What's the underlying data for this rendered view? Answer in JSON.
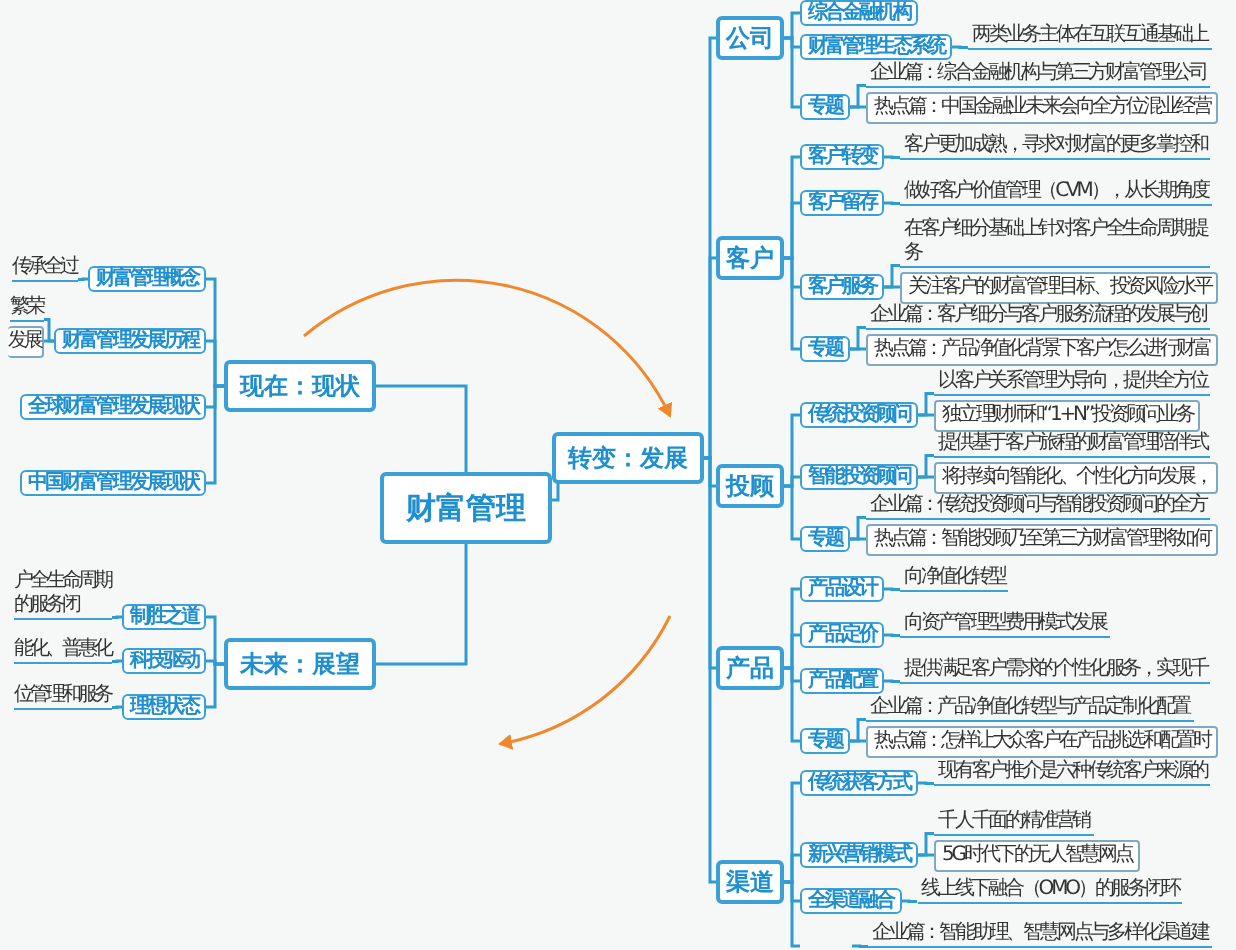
{
  "root": {
    "label": "财富管理"
  },
  "branches": [
    {
      "label": "现在：现状",
      "children": [
        {
          "label": "财富管理概念",
          "notes": [
            {
              "lines": [
                "传承全过"
              ],
              "boxed": false
            }
          ]
        },
        {
          "label": "财富管理发展历程",
          "notes": [
            {
              "lines": [
                "繁荣"
              ],
              "boxed": false
            },
            {
              "lines": [
                "发展"
              ],
              "boxed": true
            }
          ]
        },
        {
          "label": "全球财富管理发展现状"
        },
        {
          "label": "中国财富管理发展现状"
        }
      ]
    },
    {
      "label": "转变：发展",
      "children": [
        {
          "label": "公司",
          "children": [
            {
              "label": "综合金融机构"
            },
            {
              "label": "财富管理生态系统",
              "notes": [
                {
                  "lines": [
                    "两类业务主体在互联互通基础上"
                  ],
                  "boxed": false
                }
              ]
            },
            {
              "label": "专题",
              "notes": [
                {
                  "lines": [
                    "企业篇：综合金融机构与第三方财富管理公司"
                  ],
                  "boxed": false
                },
                {
                  "lines": [
                    "热点篇：中国金融业未来会向全方位混业经营"
                  ],
                  "boxed": true
                }
              ]
            }
          ]
        },
        {
          "label": "客户",
          "children": [
            {
              "label": "客户转变",
              "notes": [
                {
                  "lines": [
                    "客户更加成熟，寻求对财富的更多掌控和"
                  ],
                  "boxed": false
                }
              ]
            },
            {
              "label": "客户留存",
              "notes": [
                {
                  "lines": [
                    "做好客户价值管理（CVM），从长期角度"
                  ],
                  "boxed": false
                }
              ]
            },
            {
              "label": "客户服务",
              "notes": [
                {
                  "lines": [
                    "在客户细分基础上针对客户全生命周期提",
                    "务"
                  ],
                  "boxed": false
                },
                {
                  "lines": [
                    "关注客户的财富管理目标、投资风险水平"
                  ],
                  "boxed": true
                }
              ]
            },
            {
              "label": "专题",
              "notes": [
                {
                  "lines": [
                    "企业篇：客户细分与客户服务流程的发展与创"
                  ],
                  "boxed": false
                },
                {
                  "lines": [
                    "热点篇：产品净值化背景下客户怎么进行财富"
                  ],
                  "boxed": true
                }
              ]
            }
          ]
        },
        {
          "label": "投顾",
          "children": [
            {
              "label": "传统投资顾问",
              "notes": [
                {
                  "lines": [
                    "以客户关系管理为导向，提供全方位"
                  ],
                  "boxed": false
                },
                {
                  "lines": [
                    "独立理财师和“1+N”投资顾问业务"
                  ],
                  "boxed": true
                }
              ]
            },
            {
              "label": "智能投资顾问",
              "notes": [
                {
                  "lines": [
                    "提供基于客户旅程的财富管理陪伴式"
                  ],
                  "boxed": false
                },
                {
                  "lines": [
                    "将持续向智能化、个性化方向发展，"
                  ],
                  "boxed": true
                }
              ]
            },
            {
              "label": "专题",
              "notes": [
                {
                  "lines": [
                    "企业篇：传统投资顾问与智能投资顾问的全方"
                  ],
                  "boxed": false
                },
                {
                  "lines": [
                    "热点篇：智能投顾乃至第三方财富管理将如何"
                  ],
                  "boxed": true
                }
              ]
            }
          ]
        },
        {
          "label": "产品",
          "children": [
            {
              "label": "产品设计",
              "notes": [
                {
                  "lines": [
                    "向净值化转型"
                  ],
                  "boxed": false
                }
              ]
            },
            {
              "label": "产品定价",
              "notes": [
                {
                  "lines": [
                    "向资产管理型费用模式发展"
                  ],
                  "boxed": false
                }
              ]
            },
            {
              "label": "产品配置",
              "notes": [
                {
                  "lines": [
                    "提供满足客户需求的个性化服务，实现千"
                  ],
                  "boxed": false
                }
              ]
            },
            {
              "label": "专题",
              "notes": [
                {
                  "lines": [
                    "企业篇：产品净值化转型与产品定制化配置"
                  ],
                  "boxed": false
                },
                {
                  "lines": [
                    "热点篇：怎样让大众客户在产品挑选和配置时"
                  ],
                  "boxed": true
                }
              ]
            }
          ]
        },
        {
          "label": "渠道",
          "children": [
            {
              "label": "传统获客方式",
              "notes": [
                {
                  "lines": [
                    "现有客户推介是六种传统客户来源的"
                  ],
                  "boxed": false
                }
              ]
            },
            {
              "label": "新兴营销模式",
              "notes": [
                {
                  "lines": [
                    "千人千面的精准营销"
                  ],
                  "boxed": false
                },
                {
                  "lines": [
                    "5G时代下的无人智慧网点"
                  ],
                  "boxed": true
                }
              ]
            },
            {
              "label": "全渠道融合",
              "notes": [
                {
                  "lines": [
                    "线上线下融合（OMO）的服务闭环"
                  ],
                  "boxed": false
                }
              ]
            },
            {
              "notes": [
                {
                  "lines": [
                    "企业篇：智能助理、智慧网点与多样化渠道建"
                  ],
                  "boxed": false
                }
              ]
            }
          ]
        }
      ]
    },
    {
      "label": "未来：展望",
      "children": [
        {
          "label": "制胜之道",
          "notes": [
            {
              "lines": [
                "户全生命周期",
                "的服务闭"
              ],
              "boxed": false
            }
          ]
        },
        {
          "label": "科技驱动",
          "notes": [
            {
              "lines": [
                "能化、普惠化"
              ],
              "boxed": false
            }
          ]
        },
        {
          "label": "理想状态",
          "notes": [
            {
              "lines": [
                "位管理和服务"
              ],
              "boxed": false
            }
          ]
        }
      ]
    }
  ]
}
